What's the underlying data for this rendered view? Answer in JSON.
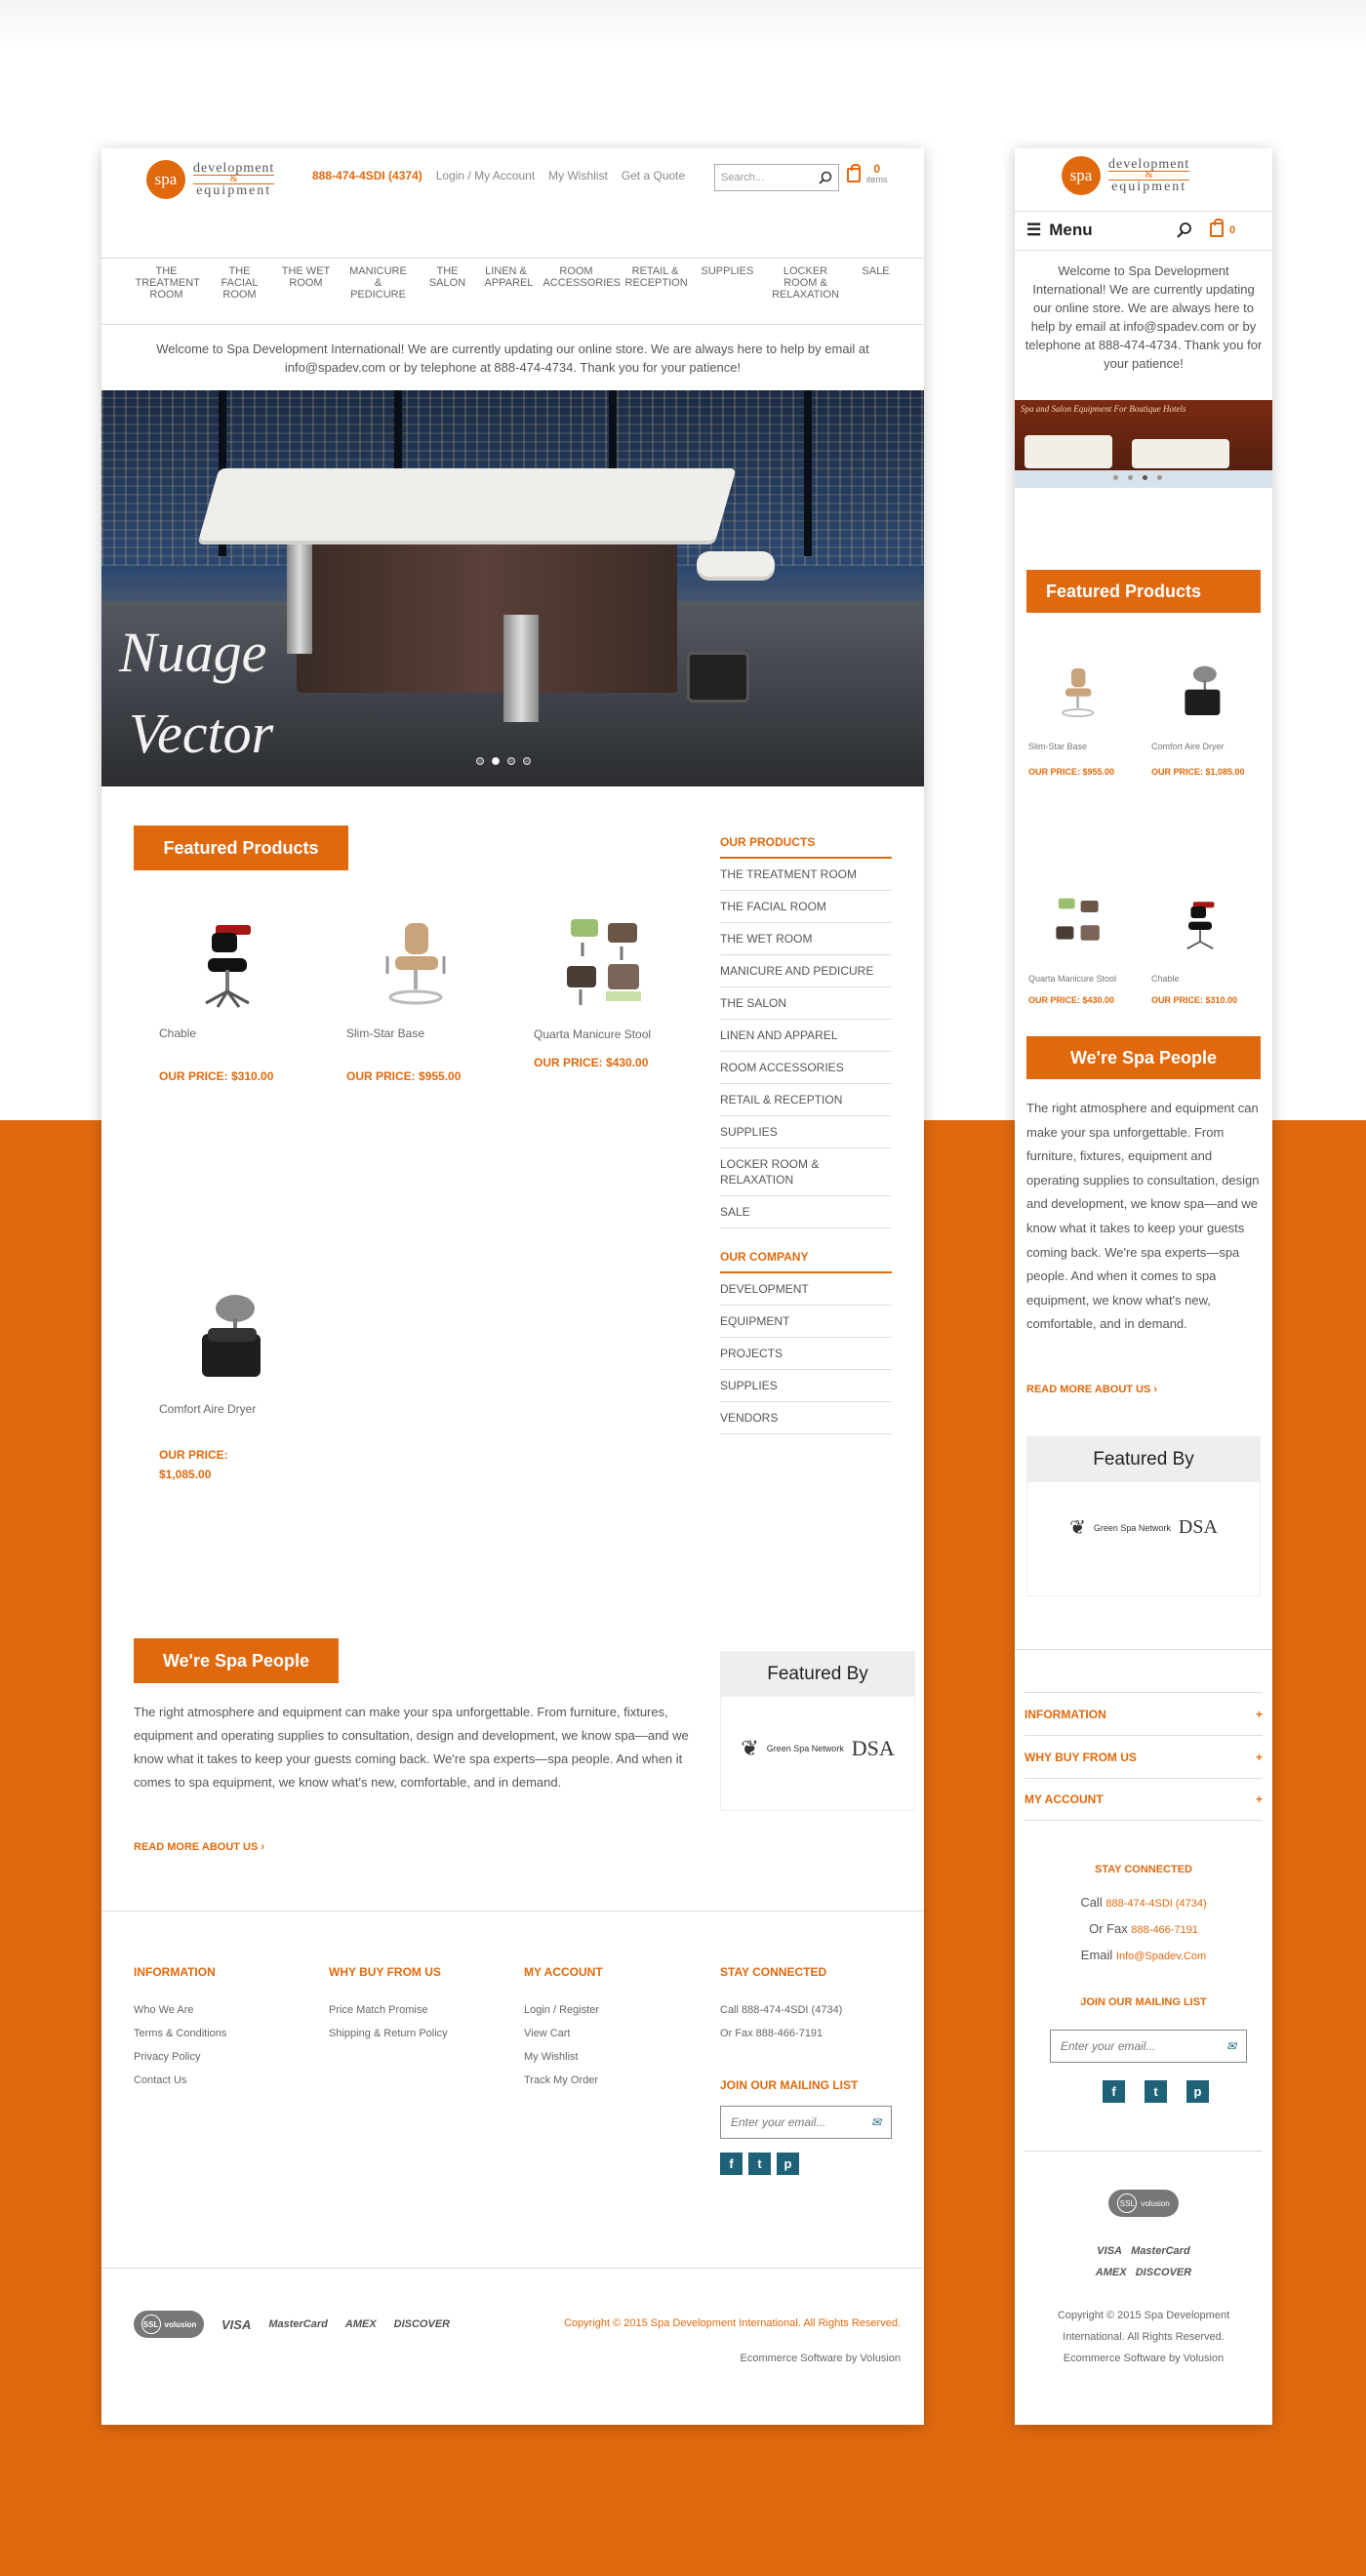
{
  "brand": {
    "logo_mark": "spa",
    "logo_top": "development",
    "logo_amp": "&",
    "logo_bottom": "equipment"
  },
  "header": {
    "phone": "888-474-4SDI (4374)",
    "login": "Login / My Account",
    "wishlist": "My Wishlist",
    "quote": "Get a Quote",
    "search_placeholder": "Search...",
    "cart_count": "0",
    "cart_label": "items"
  },
  "nav": [
    "THE TREATMENT ROOM",
    "THE FACIAL ROOM",
    "THE WET ROOM",
    "MANICURE & PEDICURE",
    "THE SALON",
    "LINEN & APPAREL",
    "ROOM ACCESSORIES",
    "RETAIL & RECEPTION",
    "SUPPLIES",
    "LOCKER ROOM & RELAXATION",
    "SALE"
  ],
  "welcome": "Welcome to Spa Development International! We are currently updating our online store. We are always here to help by email at info@spadev.com or by telephone at 888-474-4734. Thank you for your patience!",
  "hero": {
    "line1": "Nuage",
    "line2": "Vector"
  },
  "featured": {
    "title": "Featured Products",
    "products": [
      {
        "name": "Chable",
        "price_label": "OUR PRICE:",
        "price": "$310.00"
      },
      {
        "name": "Slim-Star Base",
        "price_label": "OUR PRICE:",
        "price": "$955.00"
      },
      {
        "name": "Quarta Manicure Stool",
        "price_label": "OUR PRICE:",
        "price": "$430.00"
      },
      {
        "name": "Comfort Aire Dryer",
        "price_label": "OUR PRICE:",
        "price": "$1,085.00"
      }
    ]
  },
  "sidebar": {
    "products_head": "OUR PRODUCTS",
    "products": [
      "THE TREATMENT ROOM",
      "THE FACIAL ROOM",
      "THE WET ROOM",
      "MANICURE AND PEDICURE",
      "THE SALON",
      "LINEN AND APPAREL",
      "ROOM ACCESSORIES",
      "RETAIL & RECEPTION",
      "SUPPLIES",
      "LOCKER ROOM & RELAXATION",
      "SALE"
    ],
    "company_head": "OUR COMPANY",
    "company": [
      "DEVELOPMENT",
      "EQUIPMENT",
      "PROJECTS",
      "SUPPLIES",
      "VENDORS"
    ]
  },
  "about": {
    "title": "We're Spa People",
    "body": "The right atmosphere and equipment can make your spa unforgettable. From furniture, fixtures, equipment and operating supplies to consultation, design and development, we know spa—and we know what it takes to keep your guests coming back. We're spa experts—spa people. And when it comes to spa equipment, we know what's new, comfortable, and in demand.",
    "readmore": "READ MORE ABOUT US"
  },
  "featured_by": {
    "title": "Featured By",
    "logo1": "Green Spa Network",
    "logo2": "DSA"
  },
  "footer": {
    "info": {
      "head": "INFORMATION",
      "links": [
        "Who We Are",
        "Terms & Conditions",
        "Privacy Policy",
        "Contact Us"
      ]
    },
    "why": {
      "head": "WHY BUY FROM US",
      "links": [
        "Price Match Promise",
        "Shipping & Return Policy"
      ]
    },
    "account": {
      "head": "MY ACCOUNT",
      "links": [
        "Login / Register",
        "View Cart",
        "My Wishlist",
        "Track My Order"
      ]
    },
    "connect": {
      "head": "STAY CONNECTED",
      "call": "Call 888-474-4SDI (4734)",
      "fax": "Or Fax 888-466-7191"
    },
    "mailing": {
      "head": "JOIN OUR MAILING LIST",
      "placeholder": "Enter your email..."
    },
    "social": [
      "f",
      "t",
      "p"
    ]
  },
  "bottom": {
    "ssl_badge": "SSL",
    "ssl_label": "volusion",
    "payments": [
      "VISA",
      "MasterCard",
      "AMEX",
      "DISCOVER"
    ],
    "copyright": "Copyright © 2015 Spa Development International. All Rights Reserved.",
    "software": "Ecommerce Software by Volusion"
  },
  "mobile": {
    "menu": "Menu",
    "cart_count": "0",
    "banner_caption": "Spa and Salon Equipment For Boutique Hotels",
    "products": [
      {
        "name": "Slim-Star Base",
        "price": "OUR PRICE: $955.00"
      },
      {
        "name": "Comfort Aire Dryer",
        "price": "OUR PRICE: $1,085.00"
      },
      {
        "name": "Quarta Manicure Stool",
        "price": "OUR PRICE: $430.00"
      },
      {
        "name": "Chable",
        "price": "OUR PRICE: $310.00"
      }
    ],
    "accordions": [
      "INFORMATION",
      "WHY BUY FROM US",
      "MY ACCOUNT"
    ],
    "call_prefix": "Call",
    "call": "888-474-4SDI (4734)",
    "fax_prefix": "Or Fax",
    "fax": "888-466-7191",
    "email_prefix": "Email",
    "email": "Info@Spadev.Com",
    "copyright": "Copyright © 2015 Spa Development International. All Rights Reserved. Ecommerce Software by Volusion"
  },
  "colors": {
    "accent": "#e0690e",
    "social": "#1f6178"
  }
}
